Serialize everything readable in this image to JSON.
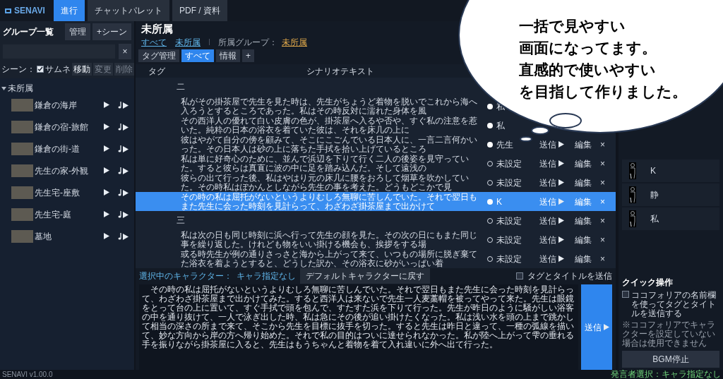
{
  "app": {
    "name": "SENAVI",
    "version": "SENAVI v1.00.0"
  },
  "nav_tabs": [
    {
      "label": "進行",
      "selected": true
    },
    {
      "label": "チャットパレット",
      "selected": false
    },
    {
      "label": "PDF / 資料",
      "selected": false
    }
  ],
  "sidebar": {
    "title": "グループ一覧",
    "buttons": [
      "管理",
      "+シーン"
    ],
    "search": {
      "clear": "×"
    },
    "scene_toolbar": {
      "label": "シーン：",
      "thumbnail": {
        "label": "サムネ",
        "checked": true
      },
      "buttons": [
        {
          "label": "移動",
          "disabled": false
        },
        {
          "label": "変更",
          "disabled": true
        },
        {
          "label": "削除",
          "disabled": true
        }
      ]
    },
    "groups": [
      {
        "name": "未所属",
        "expanded": true,
        "children": [
          {
            "name": "鎌倉の海岸"
          },
          {
            "name": "鎌倉の宿-旅館"
          },
          {
            "name": "鎌倉の街-道"
          },
          {
            "name": "先生の家-外観"
          },
          {
            "name": "先生宅-座敷"
          },
          {
            "name": "先生宅-庭"
          },
          {
            "name": "墓地"
          }
        ]
      }
    ]
  },
  "main": {
    "title": "未所属",
    "breadcrumbs": [
      "すべて",
      "未所属"
    ],
    "group_label": "所属グループ：",
    "group_link": "未所属",
    "tag_tabs": [
      {
        "label": "タグ管理",
        "selected": false
      },
      {
        "label": "すべて",
        "selected": true
      },
      {
        "label": "情報",
        "selected": false
      },
      {
        "label": "+",
        "selected": false
      }
    ],
    "table": {
      "columns": [
        "タグ",
        "シナリオテキスト"
      ],
      "rows": [
        {
          "kind": "heading",
          "text": "二",
          "selected": false
        },
        {
          "kind": "line",
          "text": "私がその掛茶屋で先生を見た時は、先生がちょうど着物を脱いでこれから海へ入ろうとするところであった。私はその時反対に濡れた身体を風",
          "selected": false,
          "character": {
            "name": "私",
            "assigned": true
          }
        },
        {
          "kind": "line",
          "text": "その西洋人の優れて白い皮膚の色が、掛茶屋へ入るや否や、すぐ私の注意を惹いた。純粋の日本の浴衣を着ていた彼は、それを床几の上に",
          "selected": false,
          "character": {
            "name": "私",
            "assigned": true
          }
        },
        {
          "kind": "line",
          "text": "彼はやがて自分の傍を顧みて、そこにこごんでいる日本人に、一言二言何かいった。その日本人は砂の上に落ちた手拭を拾い上げているところ",
          "selected": false,
          "character": {
            "name": "先生",
            "assigned": true
          },
          "actions": {
            "send": "送信",
            "edit": "編集",
            "delete": "×"
          }
        },
        {
          "kind": "line",
          "text": "私は単に好奇心のために、並んで浜辺を下りて行く二人の後姿を見守っていた。すると彼らは真直に波の中に足を踏み込んだ。そして遠浅の",
          "selected": false,
          "character": {
            "name": "未設定",
            "assigned": false
          },
          "actions": {
            "send": "送信",
            "edit": "編集",
            "delete": "×"
          }
        },
        {
          "kind": "line",
          "text": "彼らの出て行った後、私はやはり元の床几に腰をおろして烟草を吹かしていた。その時私はぽかんとしながら先生の事を考えた。どうもどこかで見",
          "selected": false,
          "character": {
            "name": "未設定",
            "assigned": false
          },
          "actions": {
            "send": "送信",
            "edit": "編集",
            "delete": "×"
          }
        },
        {
          "kind": "line",
          "text": "その時の私は屈托がないというよりむしろ無聊に苦しんでいた。それで翌日もまた先生に会った時刻を見計らって、わざわざ掛茶屋まで出かけて",
          "selected": true,
          "character": {
            "name": "K",
            "assigned": true
          },
          "actions": {
            "send": "送信",
            "edit": "編集",
            "delete": "×"
          }
        },
        {
          "kind": "heading",
          "text": "三",
          "selected": false,
          "character": {
            "name": "未設定",
            "assigned": false
          },
          "actions": {
            "send": "送信",
            "edit": "編集",
            "delete": "×"
          }
        },
        {
          "kind": "line",
          "text": "私は次の日も同じ時刻に浜へ行って先生の顔を見た。その次の日にもまた同じ事を繰り返した。けれども物をいい掛ける機会も、挨拶をする場",
          "selected": false,
          "character": {
            "name": "未設定",
            "assigned": false
          },
          "actions": {
            "send": "送信",
            "edit": "編集",
            "delete": "×"
          }
        },
        {
          "kind": "line",
          "text": "或る時先生が例の通りさっさと海から上がって来て、いつもの場所に脱ぎ棄てた浴衣を着ようとすると、どうした訳か、その浴衣に砂がいっぱい着",
          "selected": false,
          "character": {
            "name": "未設定",
            "assigned": false
          },
          "actions": {
            "send": "送信",
            "edit": "編集",
            "delete": "×"
          }
        }
      ]
    },
    "composer": {
      "character_label": "選択中のキャラクター：",
      "character_value": "キャラ指定なし",
      "reset_button": "デフォルトキャラクターに戻す",
      "send_tags": {
        "label": "タグとタイトルを送信",
        "checked": false
      },
      "text": "　その時の私は屈托がないというよりむしろ無聊に苦しんでいた。それで翌日もまた先生に会った時刻を見計らって、わざわざ掛茶屋まで出かけてみた。すると西洋人は来ないで先生一人麦藁帽を被ってやって来た。先生は眼鏡をとって台の上に置いて、すぐ手拭で頭を包んで、すたすた浜を下りて行った。先生が昨日のように騒がしい浴客の中を通り抜けて、一人で泳ぎ出した時、私は急にその後が追い掛けたくなった。私は浅い水を頭の上まで跳かして相当の深さの所まで来て、そこから先生を目標に抜手を切った。すると先生は昨日と違って、一種の弧線を描いて、妙な方向から岸の方へ帰り始めた。それで私の目的はついに達せられなかった。私が陸へ上がって雫の垂れる手を振りながら掛茶屋に入ると、先生はもうちゃんと着物を着て入れ違いに外へ出て行った。",
      "send_button": "送信"
    }
  },
  "right_panel": {
    "characters": [
      {
        "name": "K"
      },
      {
        "name": "静"
      },
      {
        "name": "私"
      }
    ],
    "quick": {
      "title": "クイック操作",
      "option": {
        "label": "ココフォリアの名前欄を使ってタグとタイトルを送信する",
        "checked": false
      },
      "note": "※ココフォリアでキャラクターを設定していない場合は使用できません",
      "bgm_button": "BGM停止"
    }
  },
  "status_bar": {
    "speaker": "発言者選択：キャラ指定なし"
  },
  "callout": {
    "lines": [
      "一括で見やすい",
      "画面になってます。",
      "直感的で使いやすい",
      "を目指して作りました。"
    ]
  }
}
